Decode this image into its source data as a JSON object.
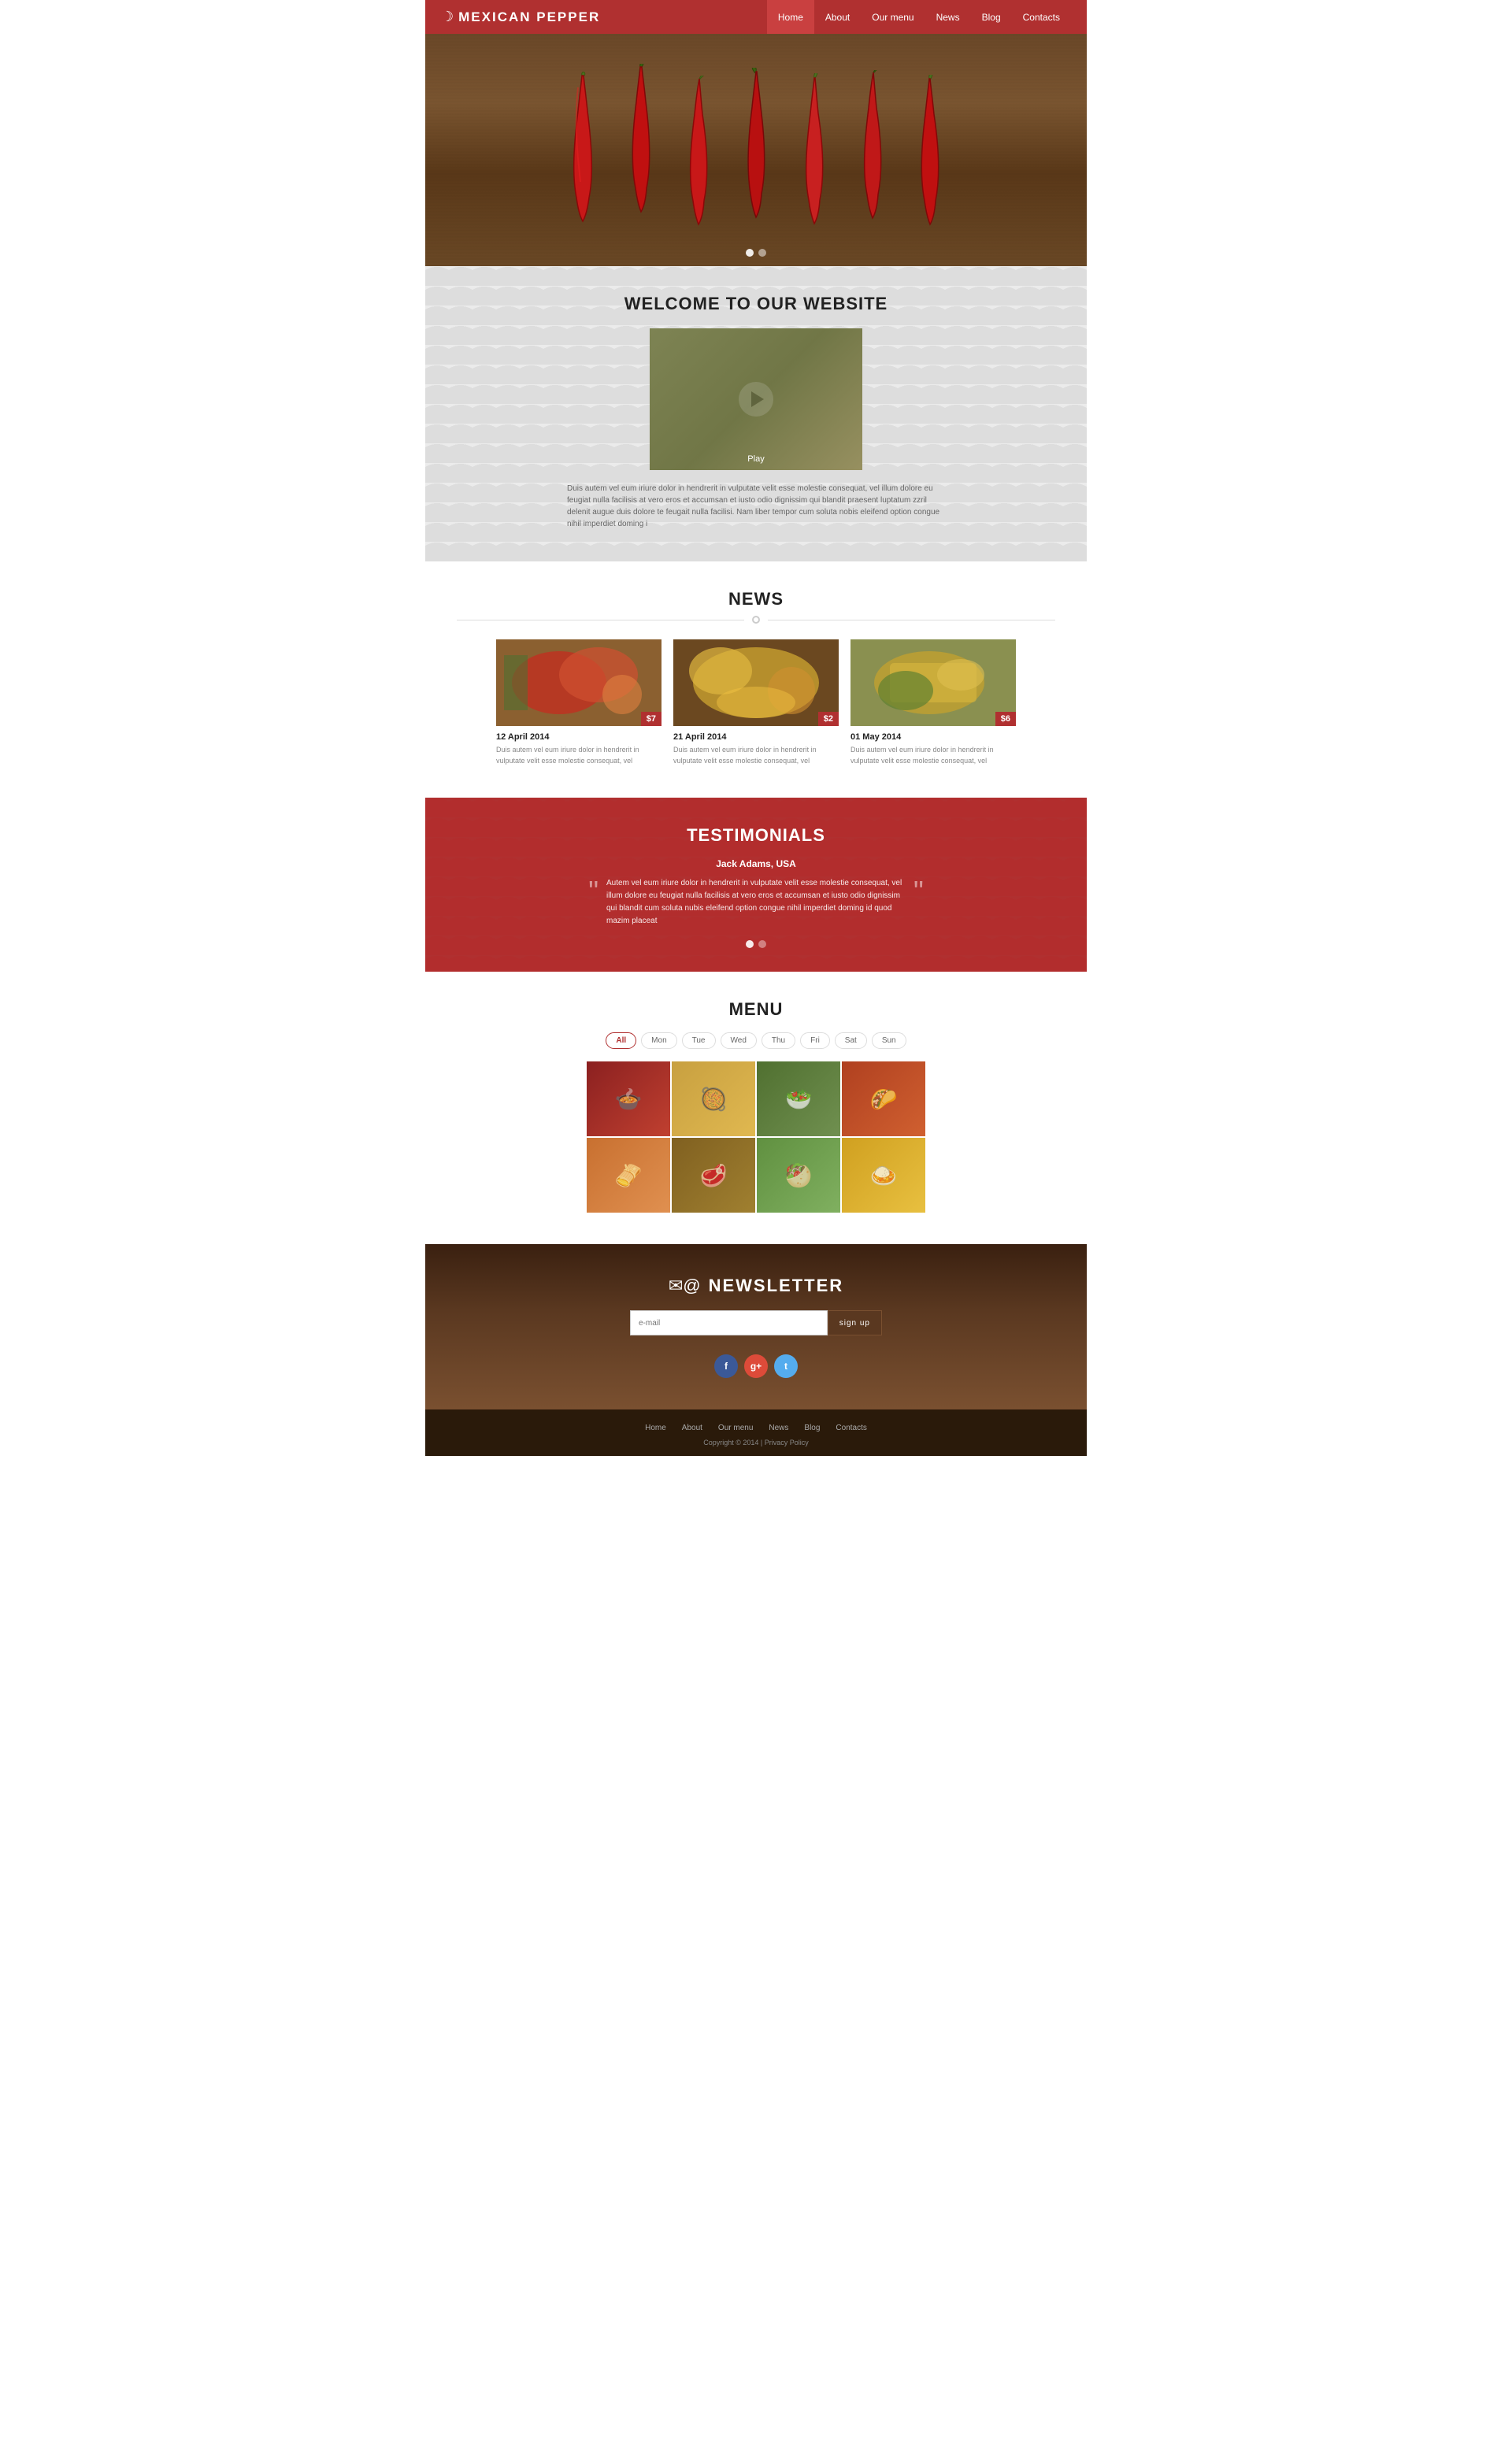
{
  "site": {
    "title": "MEXICAN PEPPER"
  },
  "nav": {
    "items": [
      {
        "label": "Home",
        "active": true
      },
      {
        "label": "About",
        "active": false
      },
      {
        "label": "Our menu",
        "active": false
      },
      {
        "label": "News",
        "active": false
      },
      {
        "label": "Blog",
        "active": false
      },
      {
        "label": "Contacts",
        "active": false
      }
    ]
  },
  "hero": {
    "dot1_active": true,
    "dot2_active": false
  },
  "welcome": {
    "title": "WELCOME TO OUR WEBSITE",
    "play_label": "Play",
    "description": "Duis autem vel eum iriure dolor in hendrerit in vulputate velit esse molestie consequat, vel illum dolore eu feugiat nulla facilisis at vero eros et accumsan et iusto odio dignissim qui blandit praesent luptatum zzril delenit augue duis dolore te feugait nulla facilisi. Nam liber tempor cum soluta nobis eleifend option congue nihil imperdiet doming i"
  },
  "news": {
    "title": "NEWS",
    "items": [
      {
        "date": "12 April 2014",
        "price": "$7",
        "description": "Duis autem vel eum iriure dolor in hendrerit in vulputate velit esse molestie consequat, vel"
      },
      {
        "date": "21 April 2014",
        "price": "$2",
        "description": "Duis autem vel eum iriure dolor in hendrerit in vulputate velit esse molestie consequat, vel"
      },
      {
        "date": "01 May 2014",
        "price": "$6",
        "description": "Duis autem vel eum iriure dolor in hendrerit in vulputate velit esse molestie consequat, vel"
      }
    ]
  },
  "testimonials": {
    "title": "TESTIMONIALS",
    "author": "Jack Adams, USA",
    "text": "Autem vel eum iriure dolor in hendrerit in vulputate velit esse molestie consequat, vel illum dolore eu feugiat nulla facilisis at vero eros et accumsan et iusto odio dignissim qui blandit cum soluta nubis eleifend option congue nihil imperdiet doming id quod mazim placeat"
  },
  "menu": {
    "title": "MENU",
    "tabs": [
      {
        "label": "All",
        "active": true
      },
      {
        "label": "Mon",
        "active": false
      },
      {
        "label": "Tue",
        "active": false
      },
      {
        "label": "Wed",
        "active": false
      },
      {
        "label": "Thu",
        "active": false
      },
      {
        "label": "Fri",
        "active": false
      },
      {
        "label": "Sat",
        "active": false
      },
      {
        "label": "Sun",
        "active": false
      }
    ],
    "items": [
      {
        "icon": "🍲"
      },
      {
        "icon": "🥘"
      },
      {
        "icon": "🥗"
      },
      {
        "icon": "🌮"
      },
      {
        "icon": "🫔"
      },
      {
        "icon": "🥩"
      },
      {
        "icon": "🥙"
      },
      {
        "icon": "🍛"
      }
    ]
  },
  "newsletter": {
    "title": "NEWSLETTER",
    "input_placeholder": "e-mail",
    "button_label": "sign up"
  },
  "social": {
    "facebook_label": "f",
    "googleplus_label": "g+",
    "twitter_label": "t"
  },
  "footer": {
    "nav_items": [
      {
        "label": "Home"
      },
      {
        "label": "About"
      },
      {
        "label": "Our menu"
      },
      {
        "label": "News"
      },
      {
        "label": "Blog"
      },
      {
        "label": "Contacts"
      }
    ],
    "copyright": "Copyright © 2014 | Privacy Policy"
  }
}
